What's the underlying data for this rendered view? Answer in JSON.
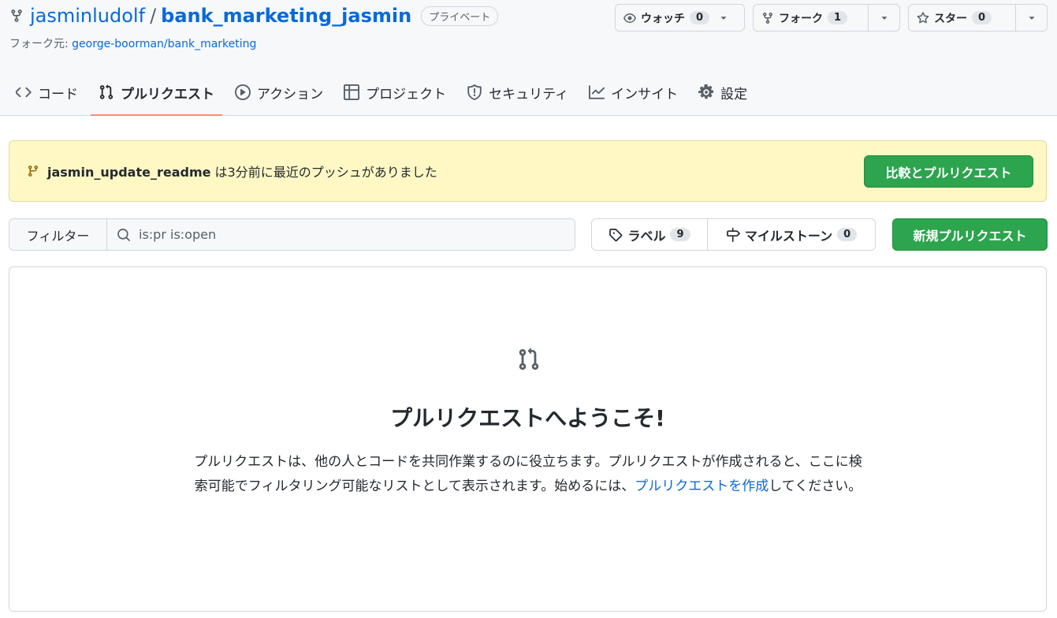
{
  "repo": {
    "owner": "jasminludolf",
    "separator": "/",
    "name": "bank_marketing_jasmin",
    "visibility": "プライベート",
    "fork_prefix": "フォーク元: ",
    "fork_source": "george-boorman/bank_marketing"
  },
  "actions": {
    "watch_label": "ウォッチ",
    "watch_count": "0",
    "fork_label": "フォーク",
    "fork_count": "1",
    "star_label": "スター",
    "star_count": "0"
  },
  "tabs": [
    {
      "label": "コード",
      "icon": "code-icon"
    },
    {
      "label": "プルリクエスト",
      "icon": "git-pull-request-icon",
      "active": true
    },
    {
      "label": "アクション",
      "icon": "play-icon"
    },
    {
      "label": "プロジェクト",
      "icon": "table-icon"
    },
    {
      "label": "セキュリティ",
      "icon": "shield-icon"
    },
    {
      "label": "インサイト",
      "icon": "graph-icon"
    },
    {
      "label": "設定",
      "icon": "gear-icon"
    }
  ],
  "flash": {
    "branch": "jasmin_update_readme",
    "message": " は3分前に最近のプッシュがありました",
    "button": "比較とプルリクエスト"
  },
  "filters": {
    "filter_label": "フィルター",
    "query": "is:pr is:open",
    "labels_label": "ラベル",
    "labels_count": "9",
    "milestones_label": "マイルストーン",
    "milestones_count": "0",
    "new_pr_button": "新規プルリクエスト"
  },
  "blankslate": {
    "title": "プルリクエストへようこそ!",
    "body": "プルリクエストは、他の人とコードを共同作業するのに役立ちます。プルリクエストが作成されると、ここに検索可能でフィルタリング可能なリストとして表示されます。始めるには、",
    "link": "プルリクエストを作成",
    "suffix": "してください。"
  },
  "colors": {
    "accent": "#0969da",
    "green": "#2da44e",
    "tab_underline": "#fd8c73",
    "flash_bg": "#fff8c5"
  }
}
